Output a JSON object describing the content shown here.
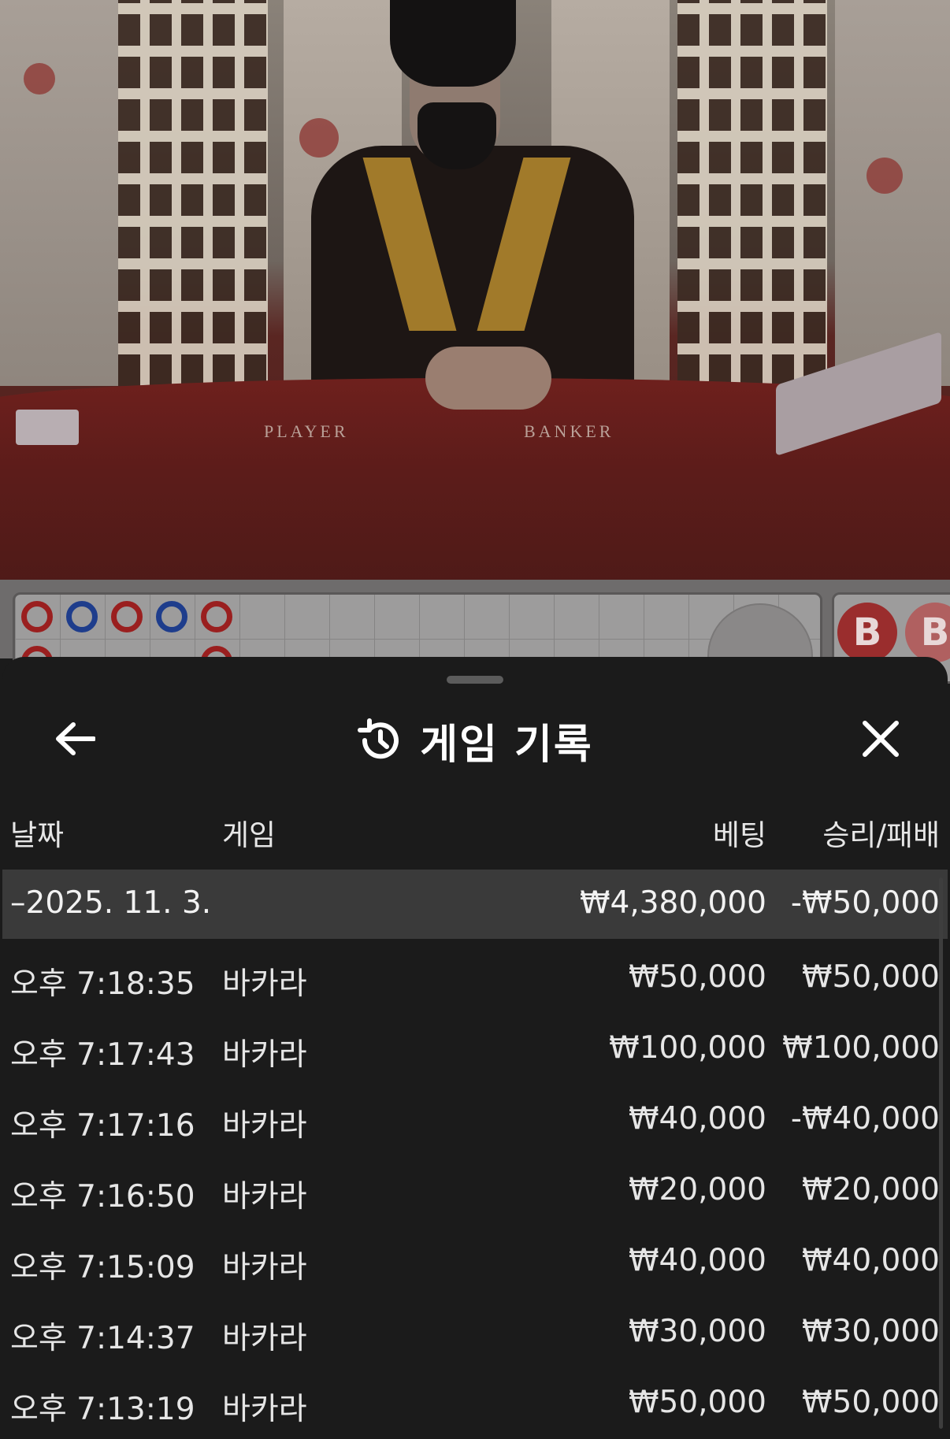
{
  "video": {
    "table_labels": [
      "PLAYER",
      "BANKER"
    ]
  },
  "scoreboard": {
    "big_road_chip": "B",
    "colors": {
      "banker": "#9a1f1f",
      "player": "#1e3d8c"
    }
  },
  "history": {
    "title": "게임 기록",
    "icons": {
      "back": "arrow-left-icon",
      "title": "history-icon",
      "close": "close-icon"
    },
    "columns": {
      "date": "날짜",
      "game": "게임",
      "bet": "베팅",
      "result": "승리/패배"
    },
    "date_group": {
      "date": "–2025. 11. 3.",
      "total_bet": "₩4,380,000",
      "total_result": "-₩50,000"
    },
    "rows": [
      {
        "time": "오후 7:18:35",
        "game": "바카라",
        "bet": "₩50,000",
        "result": "₩50,000"
      },
      {
        "time": "오후 7:17:43",
        "game": "바카라",
        "bet": "₩100,000",
        "result": "₩100,000"
      },
      {
        "time": "오후 7:17:16",
        "game": "바카라",
        "bet": "₩40,000",
        "result": "-₩40,000"
      },
      {
        "time": "오후 7:16:50",
        "game": "바카라",
        "bet": "₩20,000",
        "result": "₩20,000"
      },
      {
        "time": "오후 7:15:09",
        "game": "바카라",
        "bet": "₩40,000",
        "result": "₩40,000"
      },
      {
        "time": "오후 7:14:37",
        "game": "바카라",
        "bet": "₩30,000",
        "result": "₩30,000"
      },
      {
        "time": "오후 7:13:19",
        "game": "바카라",
        "bet": "₩50,000",
        "result": "₩50,000"
      }
    ]
  }
}
